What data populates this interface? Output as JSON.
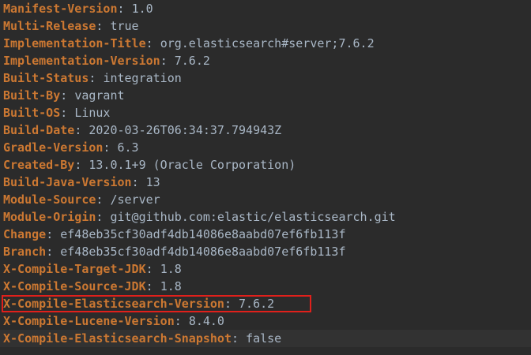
{
  "editor": {
    "lines": [
      {
        "key": "Manifest-Version",
        "value": "1.0"
      },
      {
        "key": "Multi-Release",
        "value": "true"
      },
      {
        "key": "Implementation-Title",
        "value": "org.elasticsearch#server;7.6.2"
      },
      {
        "key": "Implementation-Version",
        "value": "7.6.2"
      },
      {
        "key": "Built-Status",
        "value": "integration"
      },
      {
        "key": "Built-By",
        "value": "vagrant"
      },
      {
        "key": "Built-OS",
        "value": "Linux"
      },
      {
        "key": "Build-Date",
        "value": "2020-03-26T06:34:37.794943Z"
      },
      {
        "key": "Gradle-Version",
        "value": "6.3"
      },
      {
        "key": "Created-By",
        "value": "13.0.1+9 (Oracle Corporation)"
      },
      {
        "key": "Build-Java-Version",
        "value": "13"
      },
      {
        "key": "Module-Source",
        "value": "/server"
      },
      {
        "key": "Module-Origin",
        "value": "git@github.com:elastic/elasticsearch.git"
      },
      {
        "key": "Change",
        "value": "ef48eb35cf30adf4db14086e8aabd07ef6fb113f"
      },
      {
        "key": "Branch",
        "value": "ef48eb35cf30adf4db14086e8aabd07ef6fb113f"
      },
      {
        "key": "X-Compile-Target-JDK",
        "value": "1.8"
      },
      {
        "key": "X-Compile-Source-JDK",
        "value": "1.8"
      },
      {
        "key": "X-Compile-Elasticsearch-Version",
        "value": "7.6.2"
      },
      {
        "key": "X-Compile-Lucene-Version",
        "value": "8.4.0"
      },
      {
        "key": "X-Compile-Elasticsearch-Snapshot",
        "value": "false"
      }
    ],
    "separator": ": ",
    "colors": {
      "background": "#2b2b2b",
      "key": "#cc7832",
      "value": "#a9b7c6",
      "highlight_border": "#e0201b"
    }
  }
}
